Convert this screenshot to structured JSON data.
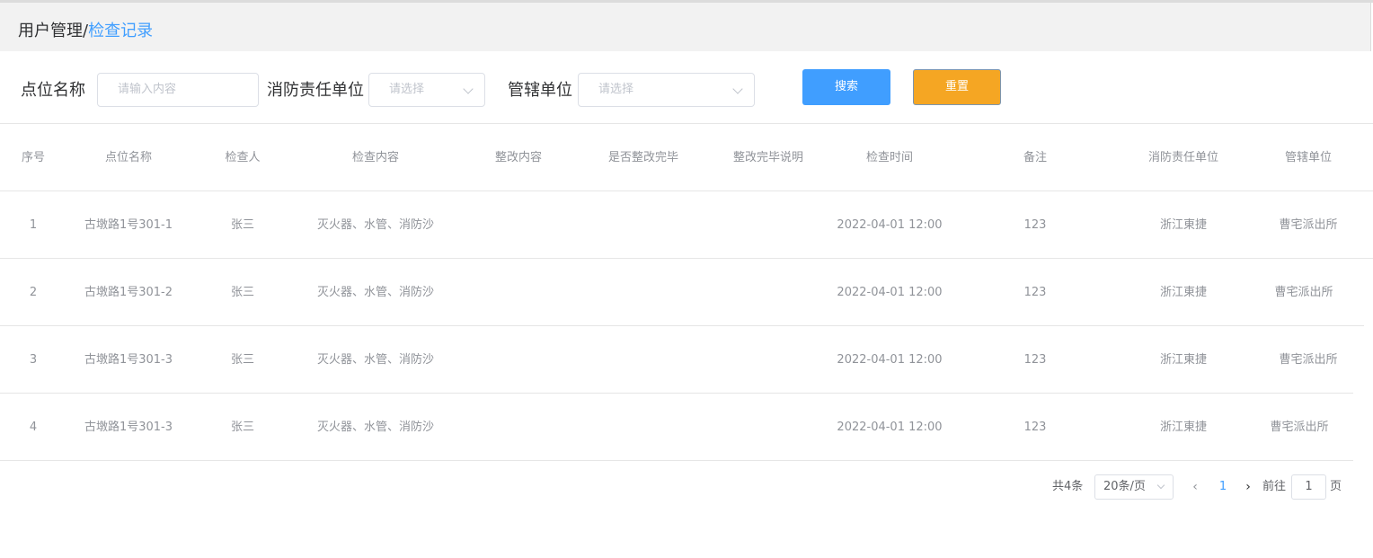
{
  "breadcrumb": {
    "parent": "用户管理",
    "separator": "/",
    "current": "检查记录"
  },
  "filters": {
    "point_name_label": "点位名称",
    "point_name_placeholder": "请输入内容",
    "fire_unit_label": "消防责任单位",
    "fire_unit_placeholder": "请选择",
    "jurisdiction_label": "管辖单位",
    "jurisdiction_placeholder": "请选择",
    "search_label": "搜索",
    "reset_label": "重置"
  },
  "colors": {
    "accent": "#409eff",
    "reset": "#f5a623",
    "header_bg": "#f2f2f2"
  },
  "table": {
    "columns": [
      "序号",
      "点位名称",
      "检查人",
      "检查内容",
      "整改内容",
      "是否整改完毕",
      "整改完毕说明",
      "检查时间",
      "备注",
      "消防责任单位",
      "管辖单位"
    ],
    "rows": [
      [
        "1",
        "古墩路1号301-1",
        "张三",
        "灭火器、水管、消防沙",
        "",
        "",
        "",
        "2022-04-01 12:00",
        "123",
        "浙江東捷",
        "曹宅派出所"
      ],
      [
        "2",
        "古墩路1号301-2",
        "张三",
        "灭火器、水管、消防沙",
        "",
        "",
        "",
        "2022-04-01 12:00",
        "123",
        "浙江東捷",
        "曹宅派出所"
      ],
      [
        "3",
        "古墩路1号301-3",
        "张三",
        "灭火器、水管、消防沙",
        "",
        "",
        "",
        "2022-04-01 12:00",
        "123",
        "浙江東捷",
        "曹宅派出所"
      ],
      [
        "4",
        "古墩路1号301-3",
        "张三",
        "灭火器、水管、消防沙",
        "",
        "",
        "",
        "2022-04-01 12:00",
        "123",
        "浙江東捷",
        "曹宅派出所"
      ]
    ]
  },
  "pagination": {
    "total": "共4条",
    "page_size": "20条/页",
    "prev_icon": "chevron-left-icon",
    "current_page": "1",
    "next_icon": "chevron-right-icon",
    "goto_label": "前往",
    "jump_value": "1",
    "page_label": "页"
  }
}
